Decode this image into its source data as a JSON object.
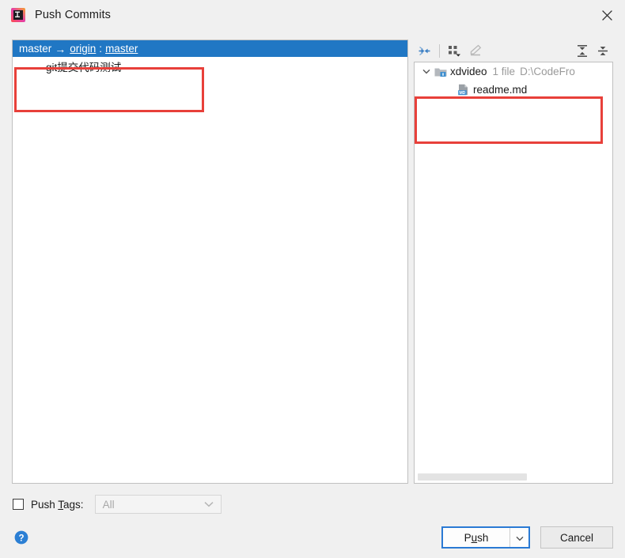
{
  "window": {
    "title": "Push Commits",
    "app_icon": "intellij-idea-icon",
    "close_icon": "close-icon"
  },
  "commits_panel": {
    "header": {
      "local_branch": "master",
      "arrow": "→",
      "remote": "origin",
      "separator": ":",
      "remote_branch": "master",
      "selected": true,
      "selection_color": "#2077c4"
    },
    "commits": [
      {
        "message": "git提交代码测试"
      }
    ]
  },
  "files_panel": {
    "toolbar": [
      {
        "name": "collapse-selection-icon",
        "label": "Expand / Collapse selection",
        "enabled": true
      },
      {
        "name": "group-by-icon",
        "label": "Group By",
        "enabled": true,
        "has_dropdown": true
      },
      {
        "name": "edit-icon",
        "label": "Edit Source",
        "enabled": false
      },
      {
        "name": "expand-all-icon",
        "label": "Expand All",
        "enabled": true
      },
      {
        "name": "collapse-all-icon",
        "label": "Collapse All",
        "enabled": true
      }
    ],
    "tree": {
      "root": {
        "expanded": true,
        "chevron": "chevron-down-icon",
        "icon": "module-folder-icon",
        "name": "xdvideo",
        "file_count": "1 file",
        "path": "D:\\CodeFro"
      },
      "children": [
        {
          "icon": "markdown-file-icon",
          "name": "readme.md"
        }
      ]
    },
    "hscroll": {
      "visible": true,
      "thumb_fraction": 0.55
    }
  },
  "options": {
    "push_tags": {
      "label_pre": "Push ",
      "label_mnemonic": "T",
      "label_post": "ags:",
      "checked": false,
      "dropdown_value": "All",
      "dropdown_enabled": false
    }
  },
  "footer": {
    "help_icon": "help-circle-icon",
    "push": {
      "label_pre": "P",
      "label_mnemonic": "u",
      "label_post": "sh",
      "focused": true,
      "dropdown_icon": "chevron-down-icon"
    },
    "cancel_label": "Cancel"
  },
  "annotations": [
    {
      "name": "annotation-commit-branch",
      "color": "#e8403a"
    },
    {
      "name": "annotation-changed-files",
      "color": "#e8403a"
    }
  ]
}
